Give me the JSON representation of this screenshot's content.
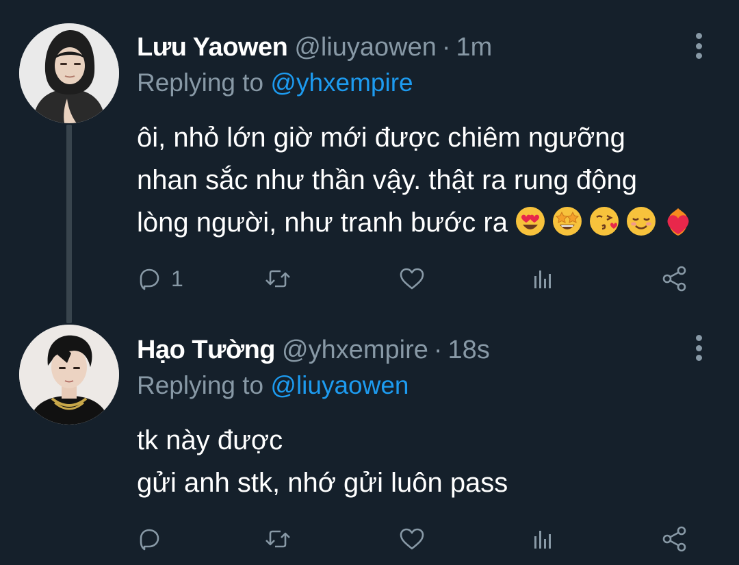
{
  "tweets": [
    {
      "display_name": "Lưu Yaowen",
      "handle": "@liuyaowen",
      "separator": "·",
      "time": "1m",
      "replying_prefix": "Replying to",
      "replying_to": "@yhxempire",
      "lines": [
        "ôi, nhỏ lớn giờ mới được chiêm ngưỡng",
        "nhan sắc như thần vậy. thật ra rung động",
        "lòng người, như tranh bước ra"
      ],
      "emojis": [
        "heart-eyes-emoji",
        "star-struck-emoji",
        "kissing-heart-emoji",
        "smiling-emoji",
        "heart-on-fire-emoji"
      ],
      "reply_count": "1"
    },
    {
      "display_name": "Hạo Tường",
      "handle": "@yhxempire",
      "separator": "·",
      "time": "18s",
      "replying_prefix": "Replying to",
      "replying_to": "@liuyaowen",
      "lines": [
        "tk này được",
        "gửi anh stk, nhớ gửi luôn pass"
      ],
      "reply_count": ""
    }
  ],
  "icons": {
    "reply": "reply-icon",
    "retweet": "retweet-icon",
    "like": "heart-icon",
    "analytics": "analytics-icon",
    "share": "share-icon",
    "more": "more-vertical-icon"
  },
  "colors": {
    "background": "#15202b",
    "text": "#ffffff",
    "muted": "#8899a6",
    "link": "#1d9bf0",
    "thread_line": "#38444d"
  }
}
